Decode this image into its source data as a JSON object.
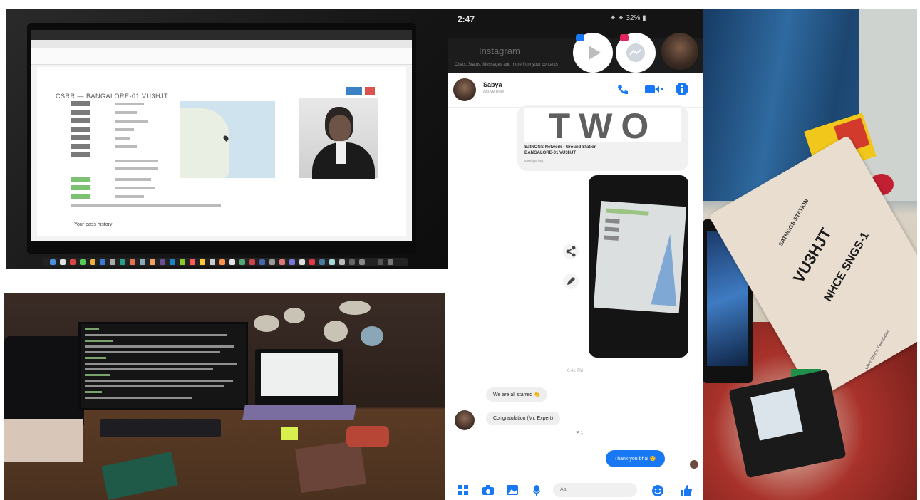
{
  "laptop_photo": {
    "page_heading": "CSRR — BANGALORE-01 VU3HJT",
    "section_heading": "Your pass history"
  },
  "chat_screenshot": {
    "status_bar": {
      "time": "2:47",
      "right": "⁕ ⁕ 32% ▮"
    },
    "instagram_bar": {
      "title": "Instagram",
      "subtitle": "Chats, Status, Messages and more from your contacts"
    },
    "header": {
      "contact_name": "Sabya",
      "contact_status": "Active now"
    },
    "card": {
      "big_text": "TWO",
      "line1": "SatNOGS Network - Ground Station",
      "line2": "BANGALORE-01 VU3HJT",
      "line3": "satnogs.org"
    },
    "timestamp": "6:41 PM",
    "incoming": [
      {
        "text": "We are all starred 👏"
      },
      {
        "text": "Congratulation (Mr. Expert)"
      }
    ],
    "reaction": "❤ 1",
    "outgoing": "Thank you bhai 😊",
    "composer_placeholder": "Aa"
  },
  "satellite_photo": {
    "box_logo": "SATNOGS STATION",
    "callsign": "VU3HJT",
    "station_id": "NHCE SNGS-1",
    "box_footer": "Libre Space Foundation"
  },
  "colors": {
    "messenger_blue": "#1877f2",
    "card_grey": "#f1f1f1",
    "dark_bar": "#141414"
  },
  "icons": [
    "play-icon",
    "messenger-icon",
    "phone-icon",
    "video-icon",
    "info-icon",
    "share-icon",
    "edit-icon",
    "grid-icon",
    "camera-icon",
    "image-icon",
    "mic-icon",
    "emoji-icon",
    "like-icon"
  ]
}
